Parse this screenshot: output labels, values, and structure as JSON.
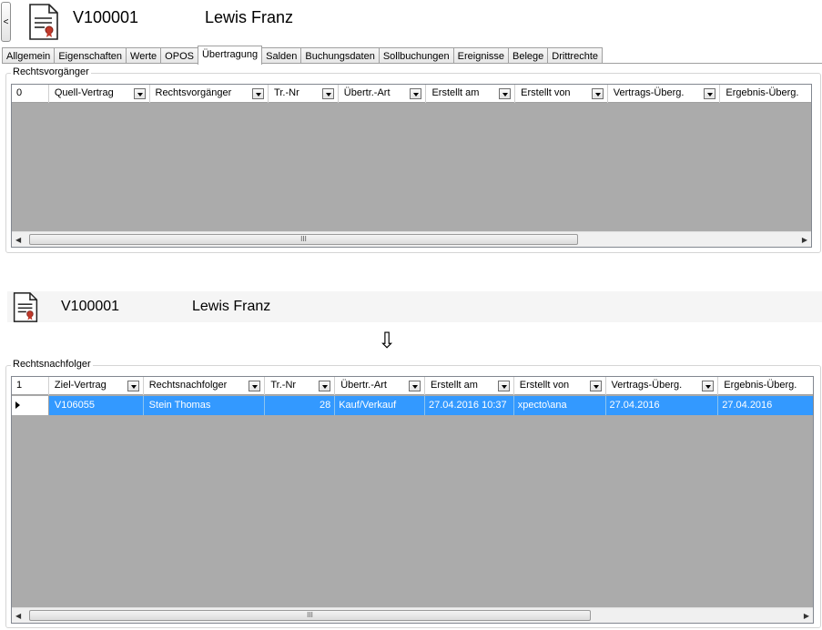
{
  "back_button": {
    "label": "<"
  },
  "header": {
    "contract_id": "V100001",
    "name": "Lewis Franz"
  },
  "tabs": [
    {
      "label": "Allgemein",
      "active": false
    },
    {
      "label": "Eigenschaften",
      "active": false
    },
    {
      "label": "Werte",
      "active": false
    },
    {
      "label": "OPOS",
      "active": false
    },
    {
      "label": "Übertragung",
      "active": true
    },
    {
      "label": "Salden",
      "active": false
    },
    {
      "label": "Buchungsdaten",
      "active": false
    },
    {
      "label": "Sollbuchungen",
      "active": false
    },
    {
      "label": "Ereignisse",
      "active": false
    },
    {
      "label": "Belege",
      "active": false
    },
    {
      "label": "Drittrechte",
      "active": false
    }
  ],
  "predecessors": {
    "title": "Rechtsvorgänger",
    "row_count": "0",
    "columns": [
      "Quell-Vertrag",
      "Rechtsvorgänger",
      "Tr.-Nr",
      "Übertr.-Art",
      "Erstellt am",
      "Erstellt von",
      "Vertrags-Überg.",
      "Ergebnis-Überg."
    ],
    "scroll_grip": "III",
    "scroll_left": "◀",
    "scroll_right": "▶"
  },
  "middle": {
    "contract_id": "V100001",
    "name": "Lewis Franz",
    "arrow": "⇩"
  },
  "successors": {
    "title": "Rechtsnachfolger",
    "row_count": "1",
    "columns": [
      "Ziel-Vertrag",
      "Rechtsnachfolger",
      "Tr.-Nr",
      "Übertr.-Art",
      "Erstellt am",
      "Erstellt von",
      "Vertrags-Überg.",
      "Ergebnis-Überg."
    ],
    "rows": [
      {
        "ziel_vertrag": "V106055",
        "rechtsnachfolger": "Stein Thomas",
        "tr_nr": "28",
        "uebertr_art": "Kauf/Verkauf",
        "erstellt_am": "27.04.2016 10:37",
        "erstellt_von": "xpecto\\ana",
        "vertrags_ueberg": "27.04.2016",
        "ergebnis_ueberg": "27.04.2016"
      }
    ],
    "scroll_grip": "III",
    "scroll_left": "◀",
    "scroll_right": "▶"
  },
  "colors": {
    "selection": "#3399ff",
    "grid_background": "#ababab"
  }
}
